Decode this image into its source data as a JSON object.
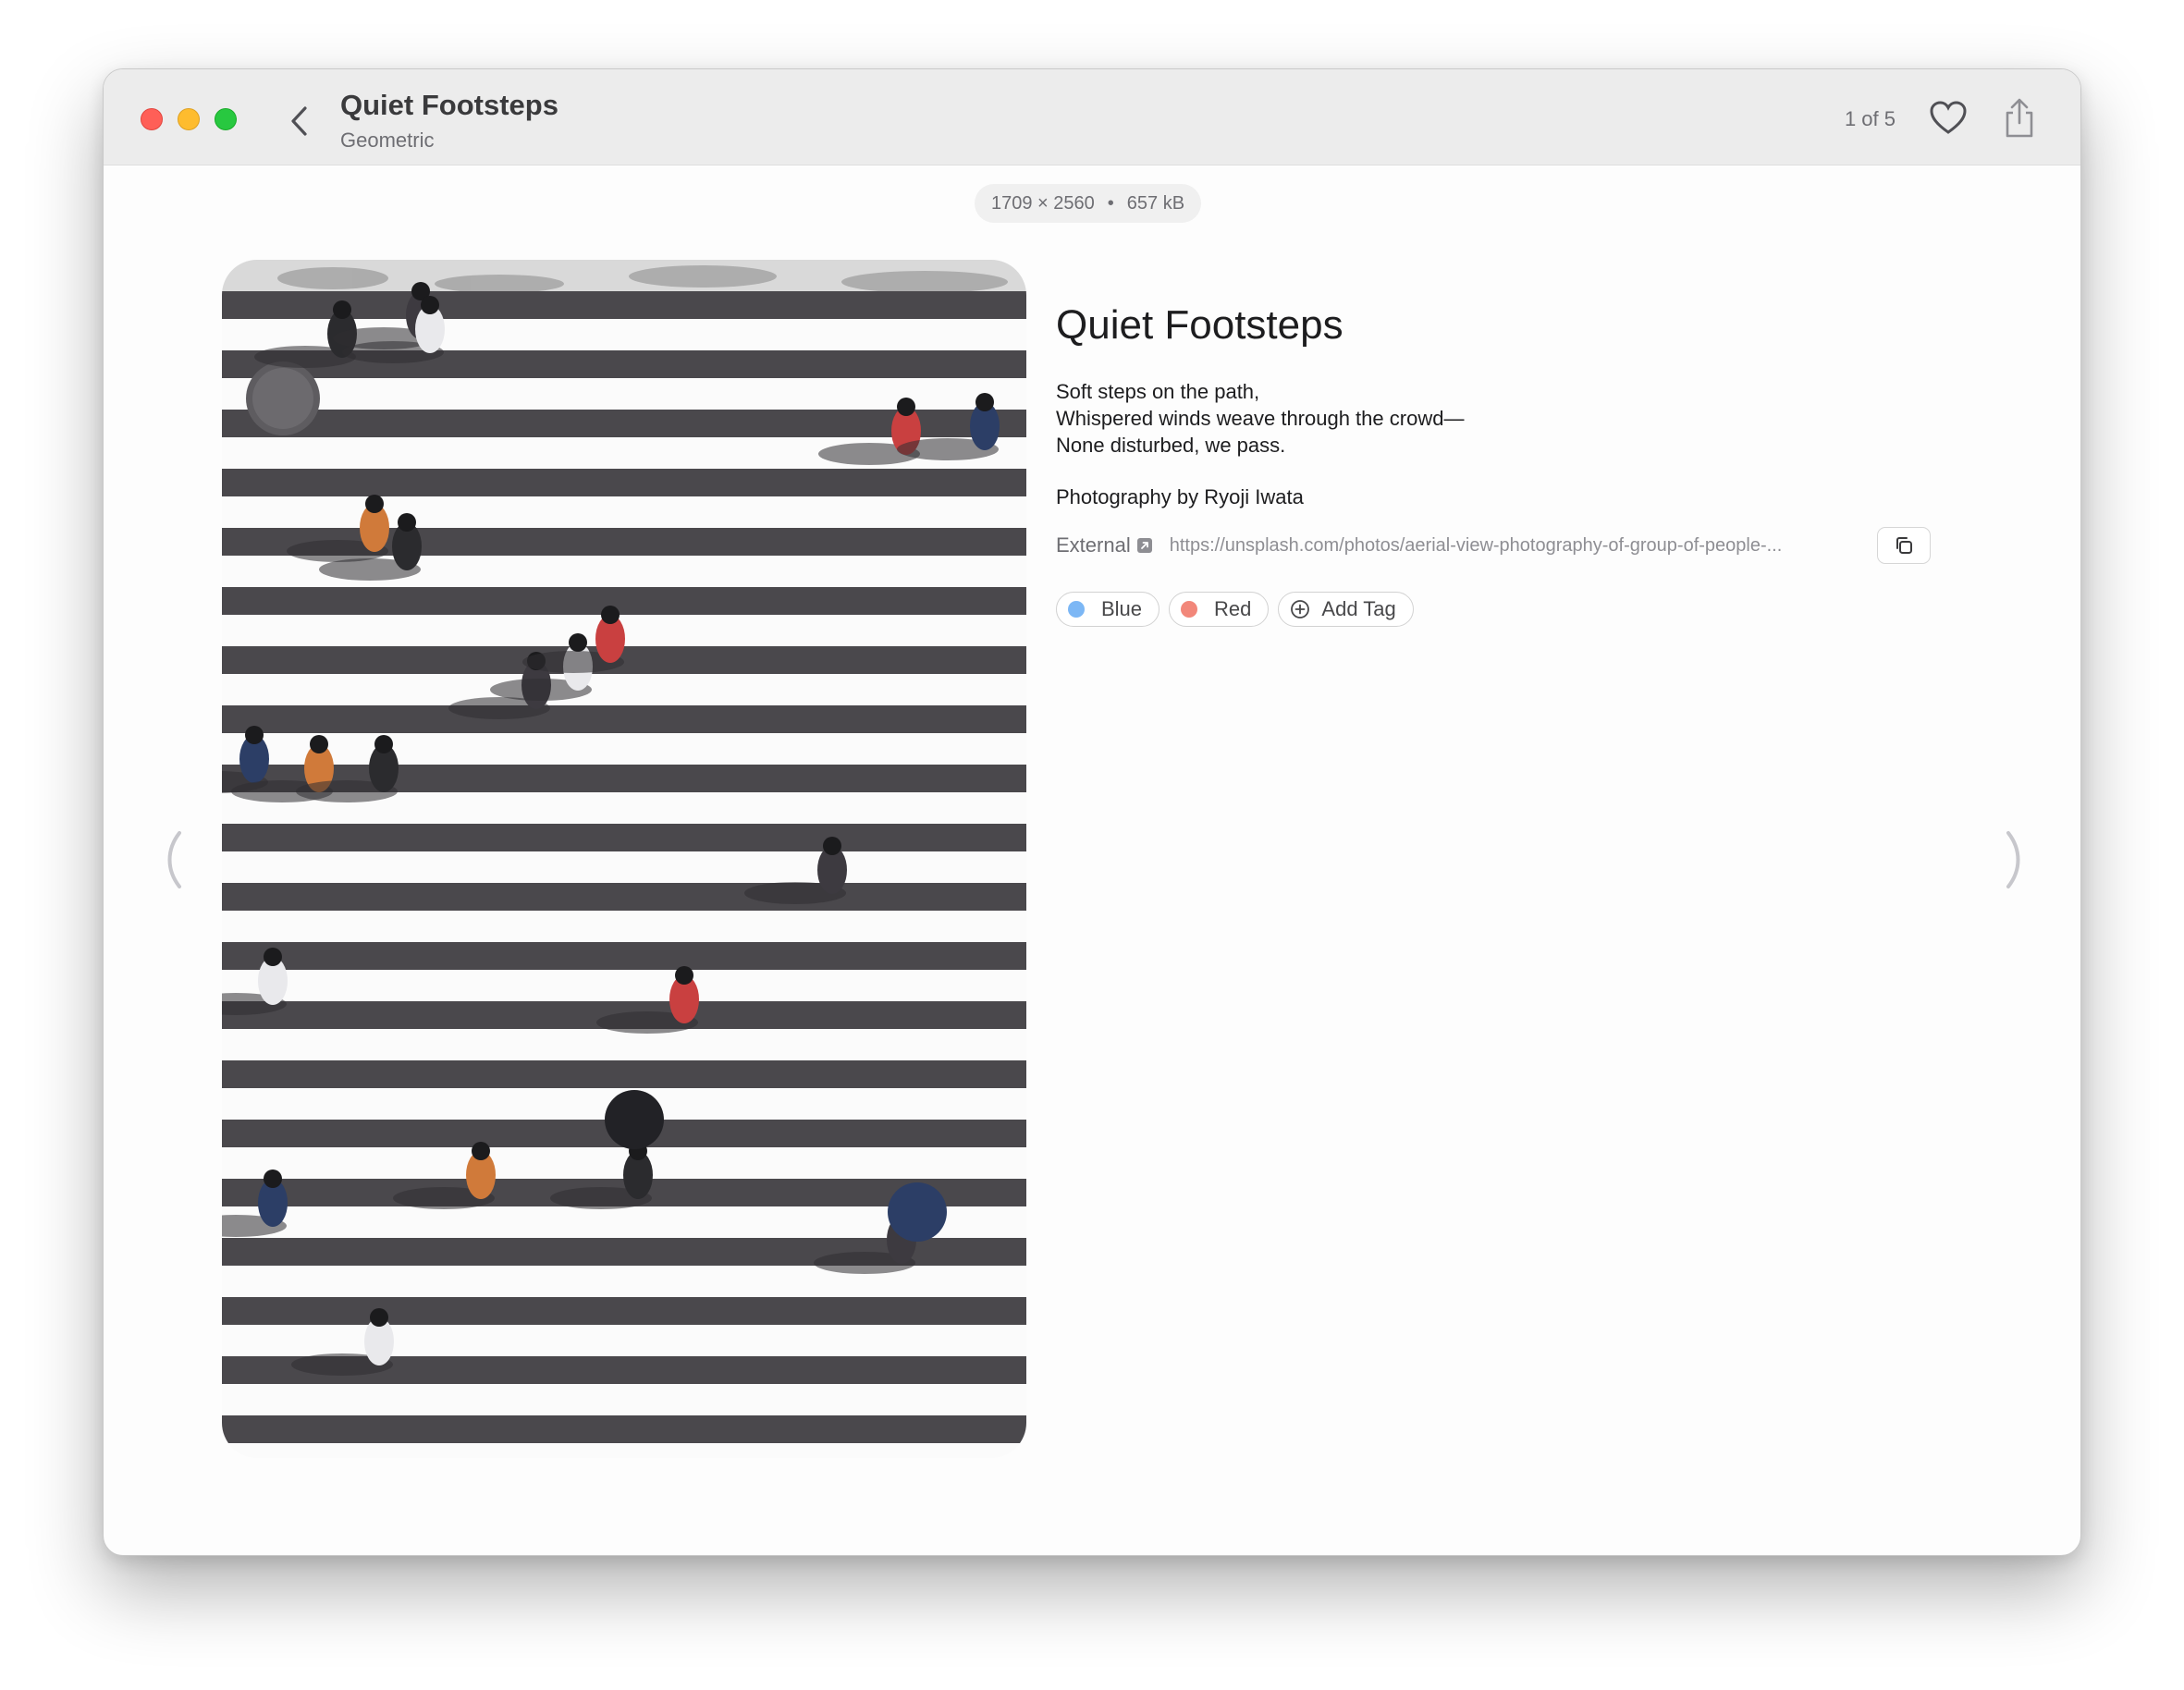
{
  "window": {
    "title": "Quiet Footsteps",
    "subtitle": "Geometric",
    "counter": "1 of 5"
  },
  "image_meta": {
    "dimensions": "1709 × 2560",
    "separator": "•",
    "size": "657 kB"
  },
  "details": {
    "title": "Quiet Footsteps",
    "poem": [
      "Soft steps on the path,",
      "Whispered winds weave through the crowd—",
      "None disturbed, we pass."
    ],
    "credit": "Photography by Ryoji Iwata",
    "link_label": "External",
    "link_url": "https://unsplash.com/photos/aerial-view-photography-of-group-of-people-..."
  },
  "tags": [
    {
      "label": "Blue",
      "color": "#7cb7f5"
    },
    {
      "label": "Red",
      "color": "#f2877a"
    }
  ],
  "add_tag_label": "Add Tag",
  "icons": {
    "back": "chevron-left-icon",
    "favorite": "heart-icon",
    "share": "share-icon",
    "external": "external-link-icon",
    "copy": "copy-icon",
    "add": "plus-circle-icon",
    "prev": "chevron-left-icon",
    "next": "chevron-right-icon"
  },
  "colors": {
    "close": "#ff5f57",
    "minimize": "#febc2e",
    "maximize": "#28c840"
  }
}
